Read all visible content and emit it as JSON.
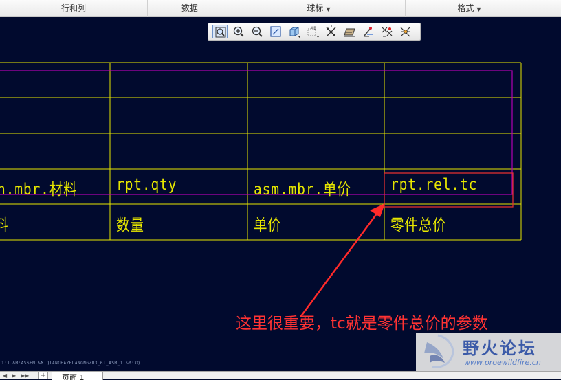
{
  "menubar": {
    "items": [
      {
        "label": "行和列",
        "has_dropdown": false
      },
      {
        "label": "数据",
        "has_dropdown": false
      },
      {
        "label": "球标",
        "has_dropdown": true
      },
      {
        "label": "格式",
        "has_dropdown": true
      }
    ]
  },
  "toolbar": {
    "tools": [
      "zoom-window-icon",
      "zoom-in-icon",
      "zoom-out-icon",
      "refit-icon",
      "orientation-icon",
      "saved-views-icon",
      "repaint-icon",
      "dimension-icon",
      "note-icon",
      "symbol-icon",
      "cross-hatch-icon"
    ]
  },
  "table": {
    "parameter_row": [
      "n.mbr.材料",
      "rpt.qty",
      "asm.mbr.单价",
      "rpt.rel.tc"
    ],
    "header_row": [
      "料",
      "数量",
      "单价",
      "零件总价"
    ],
    "line_color": "#e6e600",
    "repeat_region_color": "#b400b4",
    "highlight_color": "#ff3333"
  },
  "annotation": {
    "text": "这里很重要，tc就是零件总价的参数",
    "color": "#ff3333"
  },
  "status_bar": {
    "text": "1:1      &M:ASSEM   &M:QIANCHAZHUANGNGZU3_6I_ASM_1   &M:XQ"
  },
  "watermark": {
    "title": "野火论坛",
    "url": "www.proewildfire.cn"
  },
  "page_tabs": {
    "add_label": "+",
    "tabs": [
      "页面 1"
    ]
  }
}
